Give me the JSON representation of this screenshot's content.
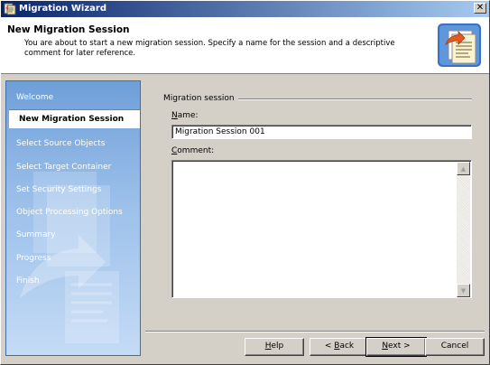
{
  "window": {
    "title": "Migration Wizard",
    "close_glyph": "✕"
  },
  "header": {
    "title": "New Migration Session",
    "description": "You are about to start a new migration session. Specify a name for the session and a descriptive comment for later reference.",
    "icon": "migration-document-icon"
  },
  "sidebar": {
    "items": [
      {
        "label": "Welcome",
        "active": false
      },
      {
        "label": "New Migration Session",
        "active": true
      },
      {
        "label": "Select Source Objects",
        "active": false
      },
      {
        "label": "Select Target Container",
        "active": false
      },
      {
        "label": "Set Security Settings",
        "active": false
      },
      {
        "label": "Object Processing Options",
        "active": false
      },
      {
        "label": "Summary",
        "active": false
      },
      {
        "label": "Progress",
        "active": false
      },
      {
        "label": "Finish",
        "active": false
      }
    ]
  },
  "form": {
    "group_label": "Migration session",
    "name_label_mnemonic": "N",
    "name_label_rest": "ame:",
    "name_value": "Migration Session 001",
    "comment_label_mnemonic": "C",
    "comment_label_rest": "omment:",
    "comment_value": ""
  },
  "buttons": {
    "help_pre": "",
    "help_mnemonic": "H",
    "help_rest": "elp",
    "back_pre": "< ",
    "back_mnemonic": "B",
    "back_rest": "ack",
    "next_mnemonic": "N",
    "next_rest": "ext >",
    "cancel": "Cancel"
  },
  "colors": {
    "titlebar_start": "#0a246a",
    "titlebar_end": "#a6caf0",
    "sidebar": "#9cc0ea",
    "face": "#d4d0c8"
  }
}
